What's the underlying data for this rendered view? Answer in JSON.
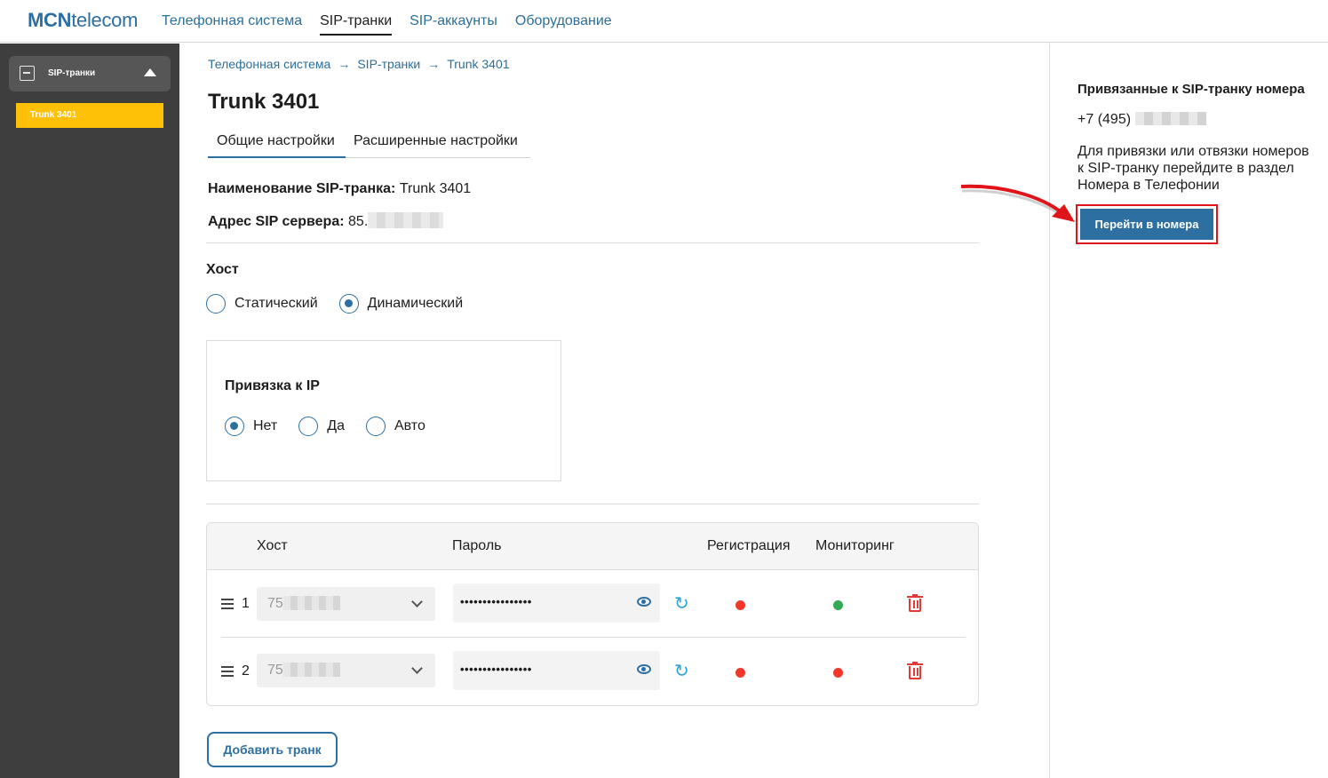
{
  "header": {
    "logo_bold": "MCN",
    "logo_rest": "telecom",
    "nav": [
      {
        "label": "Телефонная система",
        "active": false
      },
      {
        "label": "SIP-транки",
        "active": true
      },
      {
        "label": "SIP-аккаунты",
        "active": false
      },
      {
        "label": "Оборудование",
        "active": false
      }
    ]
  },
  "sidebar": {
    "group_label": "SIP-транки",
    "items": [
      {
        "label": "Trunk 3401",
        "active": true
      }
    ]
  },
  "breadcrumb": [
    "Телефонная система",
    "SIP-транки",
    "Trunk 3401"
  ],
  "page_title": "Trunk 3401",
  "tabs": [
    "Общие настройки",
    "Расширенные настройки"
  ],
  "fields": {
    "name_label": "Наименование SIP-транка:",
    "name_value": "Trunk 3401",
    "server_label": "Адрес SIP сервера:",
    "server_value": "85."
  },
  "host_section": {
    "title": "Хост",
    "options": [
      {
        "label": "Статический",
        "checked": false
      },
      {
        "label": "Динамический",
        "checked": true
      }
    ]
  },
  "ip_section": {
    "title": "Привязка к IP",
    "options": [
      {
        "label": "Нет",
        "checked": true
      },
      {
        "label": "Да",
        "checked": false
      },
      {
        "label": "Авто",
        "checked": false
      }
    ]
  },
  "table": {
    "headers": [
      "Хост",
      "Пароль",
      "Регистрация",
      "Мониторинг"
    ],
    "rows": [
      {
        "num": "1",
        "host": "75",
        "password": "••••••••••••••••",
        "registration": "red",
        "monitoring": "green"
      },
      {
        "num": "2",
        "host": "75",
        "password": "••••••••••••••••",
        "registration": "red",
        "monitoring": "red"
      }
    ]
  },
  "add_button": "Добавить транк",
  "right_panel": {
    "title": "Привязанные к SIP-транку номера",
    "phone_prefix": "+7 (495)",
    "text": "Для привязки или отвязки номеров к SIP-транку перейдите в раздел Номера в Телефонии",
    "button": "Перейти в номера"
  },
  "colors": {
    "accent": "#2e6fa1",
    "sidebar_bg": "#3e3e3e",
    "sidebar_active": "#ffc107",
    "status_red": "#f0392b",
    "status_green": "#34a853",
    "highlight": "#e0151b"
  },
  "icons": [
    "sip-trunk-icon",
    "caret-up-icon",
    "drag-handle-icon",
    "chevron-down-icon",
    "eye-icon",
    "refresh-icon",
    "trash-icon",
    "arrow-icon"
  ]
}
